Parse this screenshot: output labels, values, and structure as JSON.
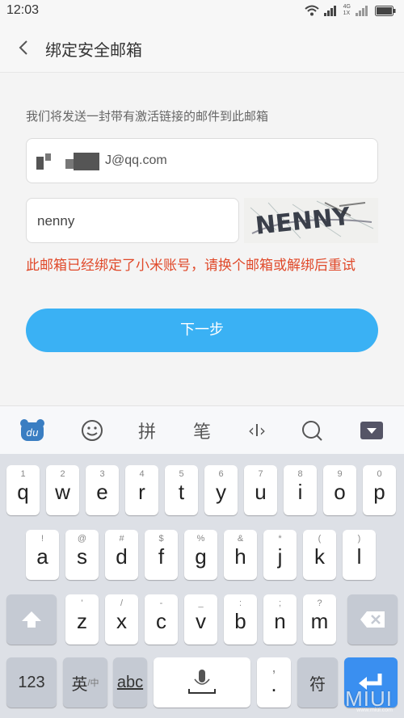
{
  "status": {
    "time": "12:03",
    "network_top": "4G",
    "network_bottom": "1X"
  },
  "header": {
    "title": "绑定安全邮箱"
  },
  "form": {
    "instruction": "我们将发送一封带有激活链接的邮件到此邮箱",
    "email_visible_suffix": "J@qq.com",
    "captcha_value": "nenny",
    "captcha_image_text": "NENNY",
    "error_message": "此邮箱已经绑定了小米账号，请换个邮箱或解绑后重试",
    "next_label": "下一步"
  },
  "ime_toolbar": {
    "items": [
      {
        "name": "du-logo",
        "label": "du"
      },
      {
        "name": "emoji",
        "label": "☺"
      },
      {
        "name": "pinyin",
        "label": "拼"
      },
      {
        "name": "stroke",
        "label": "笔"
      },
      {
        "name": "cursor",
        "label": "‹I›"
      },
      {
        "name": "search",
        "label": ""
      },
      {
        "name": "collapse",
        "label": ""
      }
    ]
  },
  "keyboard": {
    "row1": [
      {
        "hint": "1",
        "main": "q"
      },
      {
        "hint": "2",
        "main": "w"
      },
      {
        "hint": "3",
        "main": "e"
      },
      {
        "hint": "4",
        "main": "r"
      },
      {
        "hint": "5",
        "main": "t"
      },
      {
        "hint": "6",
        "main": "y"
      },
      {
        "hint": "7",
        "main": "u"
      },
      {
        "hint": "8",
        "main": "i"
      },
      {
        "hint": "9",
        "main": "o"
      },
      {
        "hint": "0",
        "main": "p"
      }
    ],
    "row2": [
      {
        "hint": "!",
        "main": "a"
      },
      {
        "hint": "@",
        "main": "s"
      },
      {
        "hint": "#",
        "main": "d"
      },
      {
        "hint": "$",
        "main": "f"
      },
      {
        "hint": "%",
        "main": "g"
      },
      {
        "hint": "&",
        "main": "h"
      },
      {
        "hint": "*",
        "main": "j"
      },
      {
        "hint": "(",
        "main": "k"
      },
      {
        "hint": ")",
        "main": "l"
      }
    ],
    "row3": [
      {
        "hint": "'",
        "main": "z"
      },
      {
        "hint": "/",
        "main": "x"
      },
      {
        "hint": "-",
        "main": "c"
      },
      {
        "hint": "_",
        "main": "v"
      },
      {
        "hint": ":",
        "main": "b"
      },
      {
        "hint": ";",
        "main": "n"
      },
      {
        "hint": "?",
        "main": "m"
      }
    ],
    "bottom": {
      "num": "123",
      "lang_main": "英",
      "lang_sub": "/中",
      "abc": "abc",
      "comma": ",",
      "period": ".",
      "symbol": "符"
    }
  },
  "watermark": {
    "text": "MIUI",
    "sub": "www.miui.com"
  }
}
